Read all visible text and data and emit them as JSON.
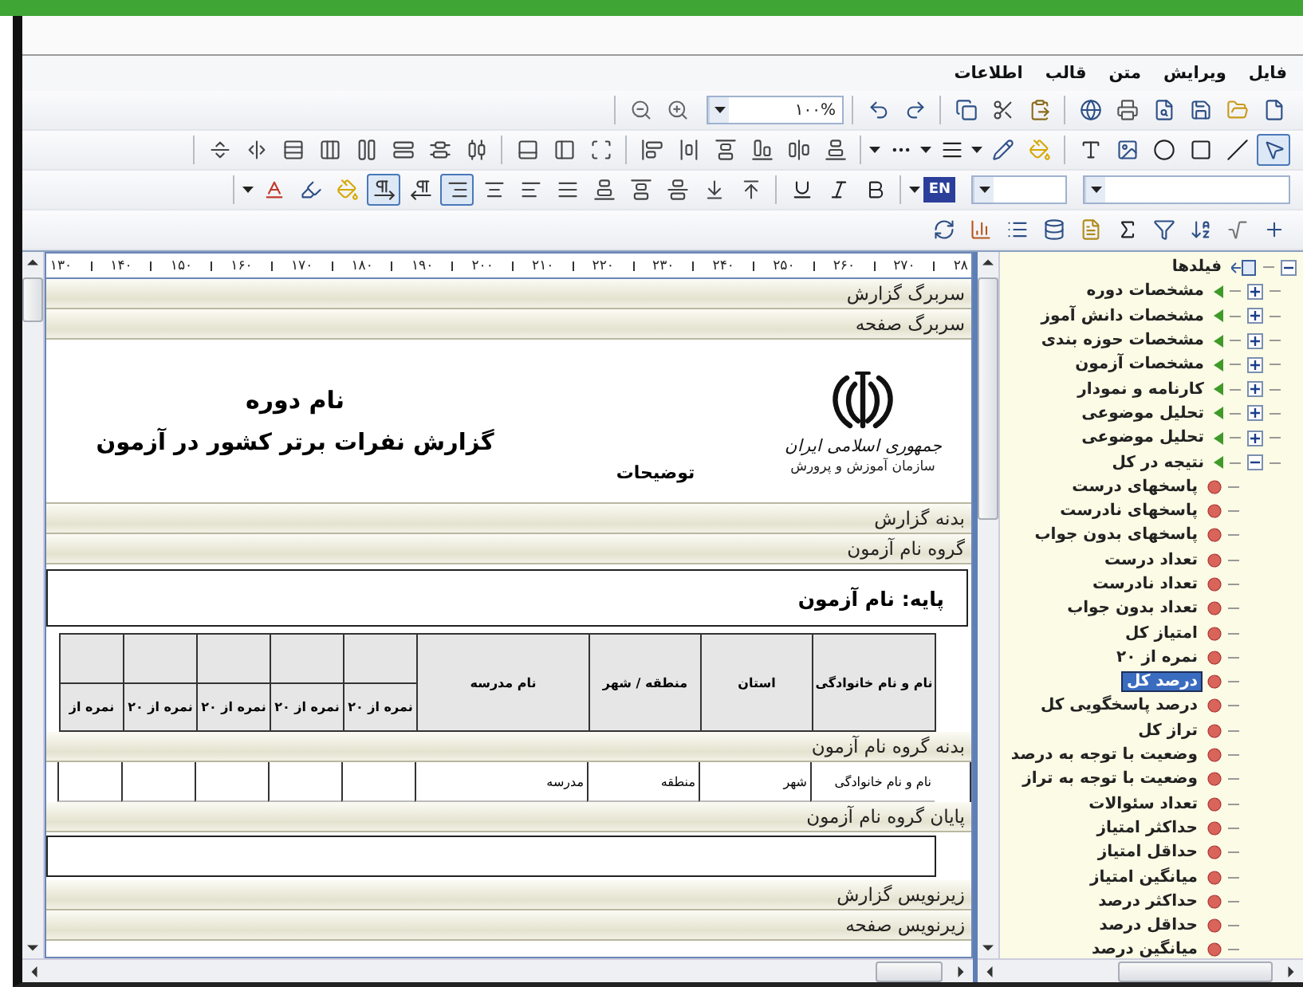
{
  "menu": [
    "فایل",
    "ویرایش",
    "متن",
    "قالب",
    "اطلاعات"
  ],
  "toolbar": {
    "zoom": "۱۰۰%",
    "language": "EN",
    "pointer_selected": true,
    "align_right_selected": true,
    "rtl_selected": true
  },
  "editor": {
    "ruler": [
      "۲۸",
      "۲۷۰",
      "۲۶۰",
      "۲۵۰",
      "۲۴۰",
      "۲۳۰",
      "۲۲۰",
      "۲۱۰",
      "۲۰۰",
      "۱۹۰",
      "۱۸۰",
      "۱۷۰",
      "۱۶۰",
      "۱۵۰",
      "۱۴۰",
      "۱۳۰"
    ],
    "sections": [
      {
        "kind": "band",
        "label": "سربرگ گزارش"
      },
      {
        "kind": "band",
        "label": "سربرگ صفحه"
      },
      {
        "kind": "header",
        "organization": "جمهوری اسلامی ایران",
        "department": "سازمان آموزش و پرورش",
        "course": "نام دوره",
        "title": "گزارش نفرات برتر کشور در آزمون",
        "description": "توضیحات"
      },
      {
        "kind": "band",
        "label": "بدنه گزارش"
      },
      {
        "kind": "band",
        "label": "گروه نام آزمون"
      },
      {
        "kind": "group_box",
        "label": "پایه: نام آزمون"
      },
      {
        "kind": "table_header",
        "columns": [
          "نام و نام خانوادگی",
          "استان",
          "منطقه / شهر",
          "نام مدرسه",
          "نمره از ۲۰",
          "نمره از ۲۰",
          "نمره از ۲۰",
          "نمره از ۲۰",
          "نمره از"
        ]
      },
      {
        "kind": "band",
        "label": "بدنه گروه نام آزمون"
      },
      {
        "kind": "data_row",
        "cells": [
          "نام و نام خانوادگی",
          "شهر",
          "منطقه",
          "مدرسه"
        ]
      },
      {
        "kind": "band",
        "label": "پایان گروه نام آزمون"
      },
      {
        "kind": "empty_box"
      },
      {
        "kind": "band",
        "label": "زیرنویس گزارش"
      },
      {
        "kind": "band",
        "label": "زیرنویس صفحه"
      }
    ]
  },
  "tree": {
    "label": "فیلدها",
    "kind": "root",
    "expanded": true,
    "selected": false,
    "children": [
      {
        "label": "مشخصات دوره",
        "kind": "group",
        "expanded": false,
        "selected": false
      },
      {
        "label": "مشخصات دانش آموز",
        "kind": "group",
        "expanded": false,
        "selected": false
      },
      {
        "label": "مشخصات حوزه بندی",
        "kind": "group",
        "expanded": false,
        "selected": false
      },
      {
        "label": "مشخصات آزمون",
        "kind": "group",
        "expanded": false,
        "selected": false
      },
      {
        "label": "کارنامه و نمودار",
        "kind": "group",
        "expanded": false,
        "selected": false
      },
      {
        "label": "تحلیل موضوعی",
        "kind": "group",
        "expanded": false,
        "selected": false
      },
      {
        "label": "تحلیل موضوعی",
        "kind": "group",
        "expanded": false,
        "selected": false
      },
      {
        "label": "نتیجه در کل",
        "kind": "group",
        "expanded": true,
        "selected": false,
        "children": [
          {
            "label": "پاسخهای درست",
            "kind": "field",
            "selected": false
          },
          {
            "label": "پاسخهای نادرست",
            "kind": "field",
            "selected": false
          },
          {
            "label": "پاسخهای بدون جواب",
            "kind": "field",
            "selected": false
          },
          {
            "label": "تعداد درست",
            "kind": "field",
            "selected": false
          },
          {
            "label": "تعداد نادرست",
            "kind": "field",
            "selected": false
          },
          {
            "label": "تعداد بدون جواب",
            "kind": "field",
            "selected": false
          },
          {
            "label": "امتیاز کل",
            "kind": "field",
            "selected": false
          },
          {
            "label": "نمره از ۲۰",
            "kind": "field",
            "selected": false
          },
          {
            "label": "درصد کل",
            "kind": "field",
            "selected": true
          },
          {
            "label": "درصد پاسخگویی کل",
            "kind": "field",
            "selected": false
          },
          {
            "label": "تراز کل",
            "kind": "field",
            "selected": false
          },
          {
            "label": "وضعیت با توجه به درصد",
            "kind": "field",
            "selected": false
          },
          {
            "label": "وضعیت با توجه به تراز",
            "kind": "field",
            "selected": false
          },
          {
            "label": "تعداد سئوالات",
            "kind": "field",
            "selected": false
          },
          {
            "label": "حداکثر امتیاز",
            "kind": "field",
            "selected": false
          },
          {
            "label": "حداقل امتیاز",
            "kind": "field",
            "selected": false
          },
          {
            "label": "میانگین امتیاز",
            "kind": "field",
            "selected": false
          },
          {
            "label": "حداکثر درصد",
            "kind": "field",
            "selected": false
          },
          {
            "label": "حداقل درصد",
            "kind": "field",
            "selected": false
          },
          {
            "label": "میانگین درصد",
            "kind": "field",
            "selected": false
          }
        ]
      }
    ]
  }
}
